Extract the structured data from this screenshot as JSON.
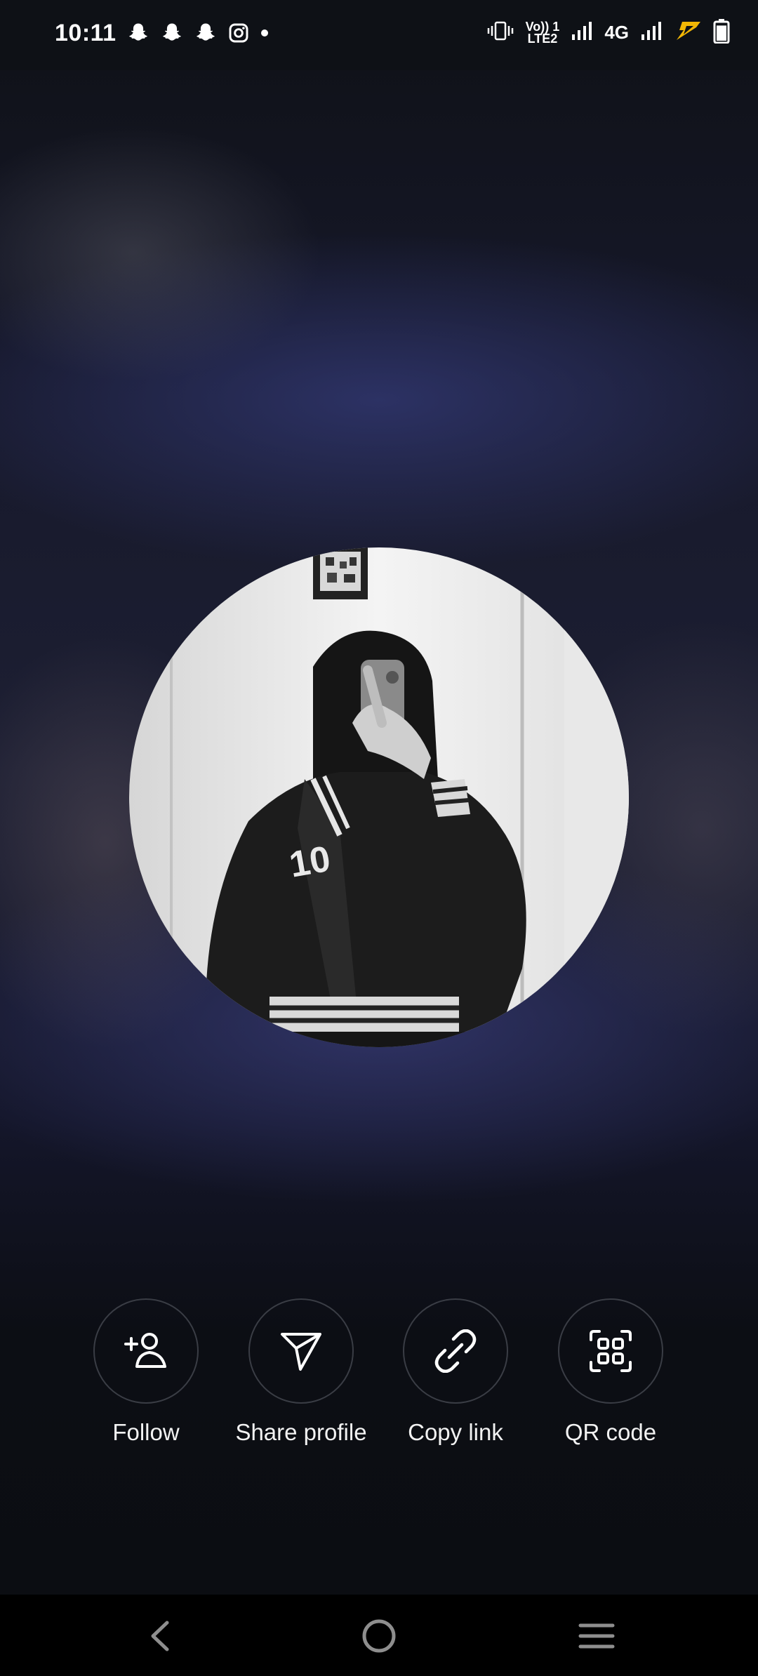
{
  "status_bar": {
    "time": "10:11",
    "notification_icons": [
      "snapchat-icon",
      "snapchat-icon",
      "snapchat-icon",
      "instagram-icon",
      "more-dot-icon"
    ],
    "volte_top": "Vo)) 1",
    "volte_bottom": "LTE2",
    "network_label": "4G",
    "battery_level": 0.9
  },
  "actions": [
    {
      "label": "Follow",
      "icon": "add-person-icon"
    },
    {
      "label": "Share profile",
      "icon": "send-icon"
    },
    {
      "label": "Copy link",
      "icon": "link-icon"
    },
    {
      "label": "QR code",
      "icon": "qr-code-icon"
    }
  ],
  "nav": {
    "items": [
      "back-icon",
      "home-icon",
      "recents-icon"
    ]
  },
  "colors": {
    "background": "#0b0d12",
    "accent_blue": "#2c3370",
    "circle_border": "#3a3d45",
    "charging_bolt": "#f2b705"
  }
}
